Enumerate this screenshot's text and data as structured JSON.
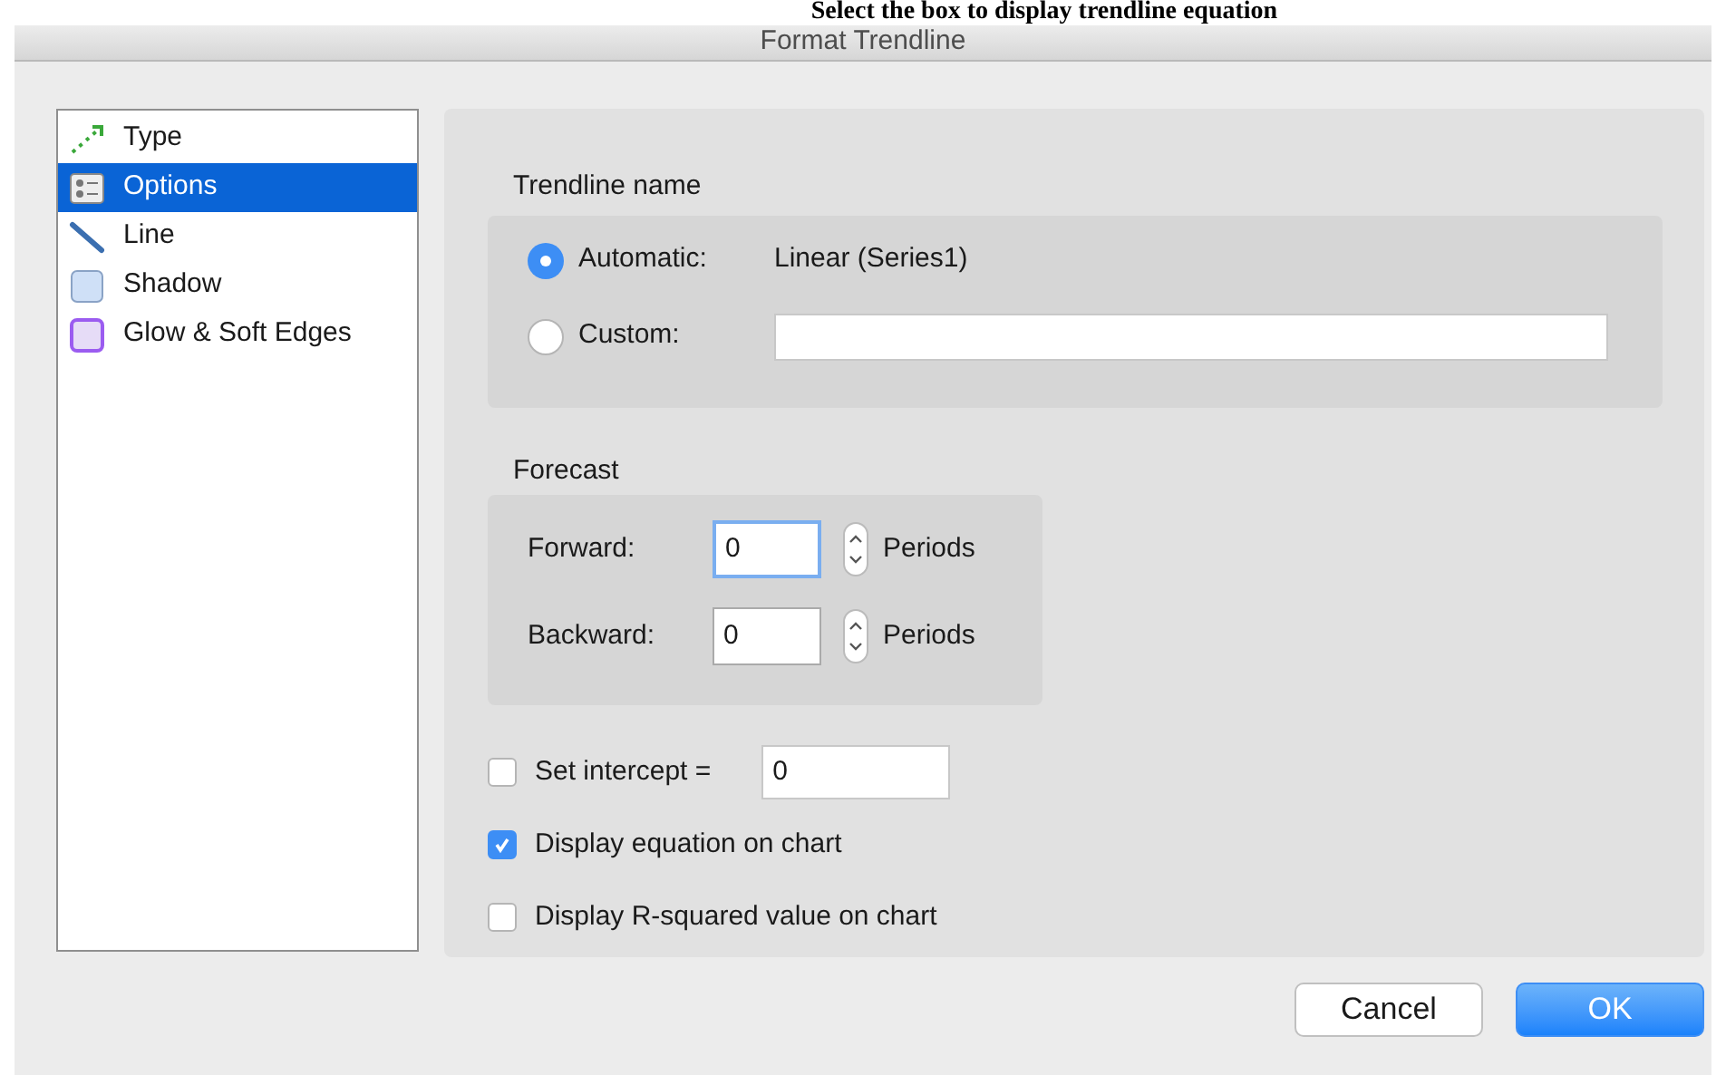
{
  "caption": "Select the box to display trendline equation",
  "window": {
    "title": "Format Trendline"
  },
  "sidebar": {
    "items": [
      {
        "label": "Type",
        "kind": "type",
        "selected": false
      },
      {
        "label": "Options",
        "kind": "options",
        "selected": true
      },
      {
        "label": "Line",
        "kind": "line",
        "selected": false
      },
      {
        "label": "Shadow",
        "kind": "shadow",
        "selected": false
      },
      {
        "label": "Glow & Soft Edges",
        "kind": "glow",
        "selected": false
      }
    ]
  },
  "trendline_name": {
    "heading": "Trendline name",
    "options": [
      {
        "label": "Automatic:",
        "selected": true,
        "value": "Linear (Series1)",
        "kind": "text"
      },
      {
        "label": "Custom:",
        "selected": false,
        "kind": "field"
      }
    ]
  },
  "forecast": {
    "heading": "Forecast",
    "rows": [
      {
        "label": "Forward:",
        "value": "0",
        "focused": true,
        "unit": "Periods"
      },
      {
        "label": "Backward:",
        "value": "0",
        "focused": false,
        "unit": "Periods"
      }
    ]
  },
  "checks": [
    {
      "label": "Set intercept =",
      "checked": false,
      "value": "0"
    },
    {
      "label": "Display equation on chart",
      "checked": true
    },
    {
      "label": "Display R-squared value on chart",
      "checked": false
    }
  ],
  "buttons": [
    {
      "label": "Cancel",
      "default": false
    },
    {
      "label": "OK",
      "default": true
    }
  ]
}
